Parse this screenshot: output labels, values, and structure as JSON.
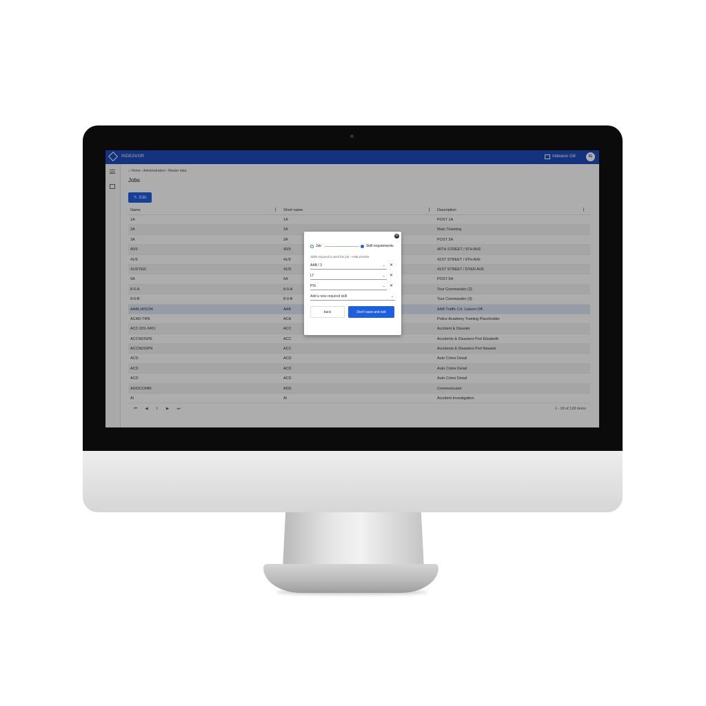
{
  "app": {
    "brand": "INDEAVOR",
    "user_name": "Indeavor Gill",
    "avatar_initials": "IG"
  },
  "breadcrumb": "⌂ Home ›  Administration ›  Master data",
  "page_title": "Jobs",
  "edit_label": "Edit",
  "grid": {
    "columns": [
      "Name",
      "Short name",
      "Description"
    ],
    "rows": [
      {
        "name": "1A",
        "short": "1A",
        "desc": "POST 1A"
      },
      {
        "name": "2A",
        "short": "2A",
        "desc": "Main Ticketing"
      },
      {
        "name": "3A",
        "short": "3A",
        "desc": "POST 3A"
      },
      {
        "name": "40/9",
        "short": "40/9",
        "desc": "40TH STREET / 9TH AVE"
      },
      {
        "name": "41/9",
        "short": "41/9",
        "desc": "41ST STREET / 9TH AVE"
      },
      {
        "name": "41/DYER",
        "short": "41/D",
        "desc": "41ST STREET / DYER AVE"
      },
      {
        "name": "5A",
        "short": "5A",
        "desc": "POST 5A"
      },
      {
        "name": "8-0-A",
        "short": "8-0-A",
        "desc": "Tour Commander (2)"
      },
      {
        "name": "8-0-B",
        "short": "8-0-B",
        "desc": "Tour Commander (3)"
      },
      {
        "name": "AABLIAISON",
        "short": "AAB",
        "desc": "AAB Traffic Crt. Liaison Off."
      },
      {
        "name": "ACAD-TRN",
        "short": "ACA",
        "desc": "Police Academy Training Placeholder"
      },
      {
        "name": "ACC-DIS-3451",
        "short": "ACC",
        "desc": "Accident & Disaster"
      },
      {
        "name": "ACCNDISPE",
        "short": "ACC",
        "desc": "Accidents & Disasters Port Elizabeth"
      },
      {
        "name": "ACCNDISPN",
        "short": "ACC",
        "desc": "Accidents & Disasters Port Newark"
      },
      {
        "name": "ACD",
        "short": "ACD",
        "desc": "Auto Crime Detail"
      },
      {
        "name": "ACD",
        "short": "ACD",
        "desc": "Auto Crime Detail"
      },
      {
        "name": "ACD",
        "short": "ACD",
        "desc": "Auto Crime Detail"
      },
      {
        "name": "ADD/COMM",
        "short": "ADD",
        "desc": "Communicator"
      },
      {
        "name": "AI",
        "short": "AI",
        "desc": "Accident Investigation"
      }
    ],
    "pager_nav": "⏮ ◀ 1 ▶ ⏭",
    "pager_count": "1 - 18 of 128 items"
  },
  "dialog": {
    "step_job": "Job",
    "step_skills": "Skill requirements",
    "subtitle": "Skills required to work the job - AABLIAISON",
    "skills": [
      "AAB / 3",
      "LT",
      "PIS"
    ],
    "add_placeholder": "Add a new required skill",
    "back_label": "back",
    "save_label": "Don't save and exit"
  }
}
